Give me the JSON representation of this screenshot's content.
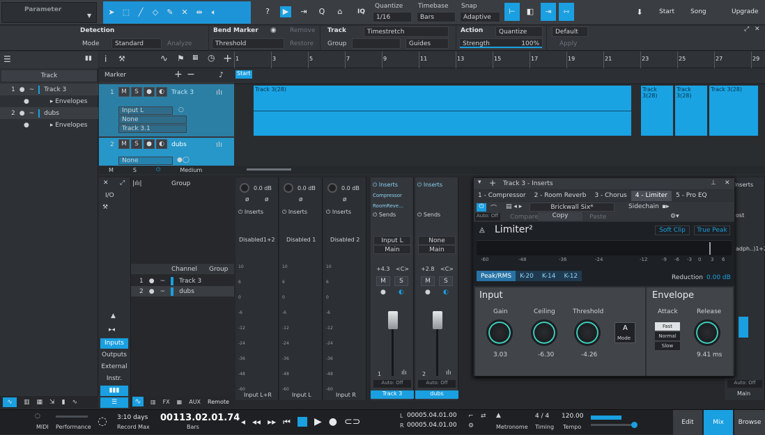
{
  "toolbar": {
    "parameter": "Parameter",
    "quantize_label": "Quantize",
    "quantize_value": "1/16",
    "timebase_label": "Timebase",
    "timebase_value": "Bars",
    "snap_label": "Snap",
    "snap_value": "Adaptive",
    "iq": "IQ",
    "start": "Start",
    "song": "Song",
    "upgrade": "Upgrade"
  },
  "inspector": {
    "detection": "Detection",
    "mode": "Mode",
    "mode_value": "Standard",
    "analyze": "Analyze",
    "bend_marker": "Bend Marker",
    "remove": "Remove",
    "threshold": "Threshold",
    "restore": "Restore",
    "track": "Track",
    "timestretch": "Timestretch",
    "group": "Group",
    "guides": "Guides",
    "action": "Action",
    "quantize": "Quantize",
    "default": "Default",
    "strength": "Strength",
    "strength_value": "100%",
    "strength_fill": 1.0,
    "apply": "Apply"
  },
  "left": {
    "track_header": "Track",
    "rows": [
      {
        "num": "1",
        "name": "Track 3"
      },
      {
        "num": "",
        "name": "Envelopes"
      },
      {
        "num": "2",
        "name": "dubs"
      },
      {
        "num": "",
        "name": "Envelopes"
      }
    ]
  },
  "arrange": {
    "marker": "Marker",
    "ruler": [
      "1",
      "3",
      "5",
      "7",
      "9",
      "11",
      "13",
      "15",
      "17",
      "19",
      "21",
      "23",
      "25",
      "27",
      "29"
    ],
    "start_marker": "Start",
    "sig": "4/4",
    "tracks": [
      {
        "num": "1",
        "m": "M",
        "s": "S",
        "name": "Track 3",
        "input": "Input L",
        "output": "None",
        "sub": "Track 3.1"
      },
      {
        "num": "2",
        "m": "M",
        "s": "S",
        "name": "dubs",
        "input": "None"
      }
    ],
    "clips": [
      "Track 3(28)",
      "Track 3(28)",
      "Track 3(28)",
      "Track 3(28)"
    ],
    "footer": {
      "m": "M",
      "s": "S",
      "zoom": "Medium"
    }
  },
  "mixer": {
    "group": "Group",
    "io": "I/O",
    "channel_hdr": "Channel",
    "group_hdr": "Group",
    "channel_list": [
      {
        "num": "1",
        "name": "Track 3"
      },
      {
        "num": "2",
        "name": "dubs"
      }
    ],
    "side_buttons": [
      "Inputs",
      "Outputs",
      "External",
      "Instr."
    ],
    "footer_tabs": [
      "FX",
      "AUX",
      "Remote"
    ],
    "inserts": "Inserts",
    "sends": "Sends",
    "input_strips": [
      {
        "gain": "0.0 dB",
        "name": "Disabled1+2",
        "bottom": "Input L+R"
      },
      {
        "gain": "0.0 dB",
        "name": "Disabled 1",
        "bottom": "Input L"
      },
      {
        "gain": "0.0 dB",
        "name": "Disabled 2",
        "bottom": "Input R"
      }
    ],
    "track_strips": [
      {
        "inserts": [
          "Compressor",
          "RoomReve..."
        ],
        "in": "Input L",
        "out": "Main",
        "vol": "+4.3",
        "pan": "<C>",
        "num": "1",
        "auto": "Auto: Off",
        "name": "Track 3"
      },
      {
        "inserts": [],
        "in": "None",
        "out": "Main",
        "vol": "+2.8",
        "pan": "<C>",
        "num": "2",
        "auto": "Auto: Off",
        "name": "dubs"
      }
    ],
    "main": {
      "inserts": "Inserts",
      "post": "ost",
      "label": "adph..)1+2",
      "auto": "Auto: Off",
      "name": "Main"
    },
    "scale": [
      "10",
      "6",
      "0",
      "-6",
      "-12",
      "-24",
      "-36",
      "-48",
      "-60"
    ]
  },
  "plugin": {
    "title": "Track 3 - Inserts",
    "tabs": [
      "1 - Compressor",
      "2 - Room Reverb",
      "3 - Chorus",
      "4 - Limiter",
      "5 - Pro EQ"
    ],
    "preset": "Brickwall Six*",
    "sidechain": "Sidechain",
    "auto": "Auto: Off",
    "compare": "Compare",
    "copy": "Copy",
    "paste": "Paste",
    "name": "Limiter²",
    "soft_clip": "Soft Clip",
    "true_peak": "True Peak",
    "meter_scale": [
      "-60",
      "-48",
      "-36",
      "-24",
      "-12",
      "-9",
      "-6",
      "-3",
      "0",
      "3",
      "6"
    ],
    "modes": [
      "Peak/RMS",
      "K-20",
      "K-14",
      "K-12"
    ],
    "reduction": "Reduction",
    "reduction_value": "0.00 dB",
    "input": "Input",
    "gain": "Gain",
    "gain_value": "3.03",
    "ceiling": "Ceiling",
    "ceiling_value": "-6.30",
    "threshold": "Threshold",
    "threshold_value": "-4.26",
    "mode_a": "A",
    "mode": "Mode",
    "envelope": "Envelope",
    "attack": "Attack",
    "attack_opts": [
      "Fast",
      "Normal",
      "Slow"
    ],
    "release": "Release",
    "release_value": "9.41 ms"
  },
  "transport": {
    "midi": "MIDI",
    "performance": "Performance",
    "days": "3:10 days",
    "record_max": "Record Max",
    "time": "00113.02.01.74",
    "bars": "Bars",
    "l": "L",
    "l_value": "00005.04.01.00",
    "r": "R",
    "r_value": "00005.04.01.00",
    "metronome": "Metronome",
    "sig": "4 / 4",
    "timing": "Timing",
    "tempo_value": "120.00",
    "tempo": "Tempo",
    "edit": "Edit",
    "mix": "Mix",
    "browse": "Browse"
  }
}
